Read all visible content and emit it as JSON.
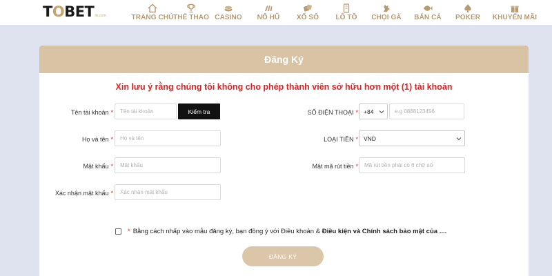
{
  "logo": {
    "main_to": "T",
    "main_o": "O",
    "main_rest": "BET",
    "sub": "nk.com"
  },
  "nav": [
    {
      "label": "TRANG CHỦ",
      "icon": "home-icon"
    },
    {
      "label": "THỂ THAO",
      "icon": "trophy-icon"
    },
    {
      "label": "CASINO",
      "icon": "chips-icon"
    },
    {
      "label": "NỔ HŨ",
      "icon": "slot-icon"
    },
    {
      "label": "XỔ SỐ",
      "icon": "dice-icon"
    },
    {
      "label": "LÔ TÔ",
      "icon": "ticket-icon"
    },
    {
      "label": "CHỌI GÀ",
      "icon": "rooster-icon"
    },
    {
      "label": "BẮN CÁ",
      "icon": "fish-icon"
    },
    {
      "label": "POKER",
      "icon": "spade-icon"
    },
    {
      "label": "KHUYẾN MÃI",
      "icon": "gift-icon"
    }
  ],
  "form": {
    "title": "Đăng Ký",
    "warning": "Xin lưu ý rằng chúng tôi không cho phép thành viên sở hữu hơn một (1) tài khoản",
    "username": {
      "label": "Tên tài khoản",
      "placeholder": "Tên tài khoản"
    },
    "check_button": "Kiểm tra",
    "fullname": {
      "label": "Họ và tên",
      "placeholder": "Họ và tên"
    },
    "password": {
      "label": "Mật khẩu",
      "placeholder": "Mật khẩu"
    },
    "confirm": {
      "label": "Xác nhận mật khẩu",
      "placeholder": "Xác nhận mật khẩu"
    },
    "phone": {
      "label": "SỐ ĐIỆN THOẠI",
      "code": "+84",
      "placeholder": "e.g 0888123456"
    },
    "currency": {
      "label": "LOẠI TIỀN",
      "value": "VND"
    },
    "withdraw_pin": {
      "label": "Mật mã rút tiền",
      "placeholder": "Mã rút tiền phải có 6 chữ số"
    },
    "required_mark": "*",
    "agree_prefix": "Bằng cách nhấp vào mẫu đăng ký, bạn đồng ý với Điều khoản &",
    "agree_bold": "Điều kiện và Chính sách bảo mật của ....",
    "submit": "ĐĂNG KÝ"
  },
  "colors": {
    "gold": "#d9c3a5",
    "red": "#e02020",
    "background": "#dfe3ef"
  }
}
